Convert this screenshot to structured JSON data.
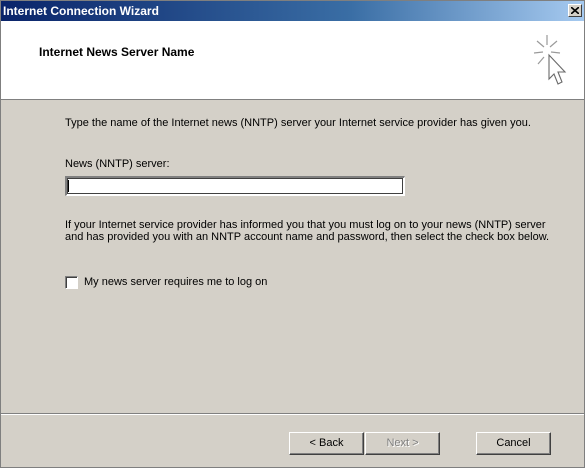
{
  "window": {
    "title": "Internet Connection Wizard",
    "close_symbol": "close-icon"
  },
  "header": {
    "title": "Internet News Server Name",
    "icon": "wizard-cursor-icon"
  },
  "content": {
    "intro": "Type the name of the Internet news (NNTP) server your Internet service provider has given you.",
    "server_label": "News (NNTP) server:",
    "server_value": "",
    "note": "If your Internet service provider has informed you that you must log on to your news (NNTP) server and has provided you with an NNTP account name and password, then select the check box below.",
    "logon_checkbox": {
      "label": "My news server requires me to log on",
      "checked": false
    }
  },
  "buttons": {
    "back": "< Back",
    "next": "Next >",
    "cancel": "Cancel"
  },
  "colors": {
    "titlebar_start": "#0a246a",
    "titlebar_end": "#a6caf0",
    "dialog_bg": "#d4d0c8",
    "header_bg": "#ffffff"
  }
}
